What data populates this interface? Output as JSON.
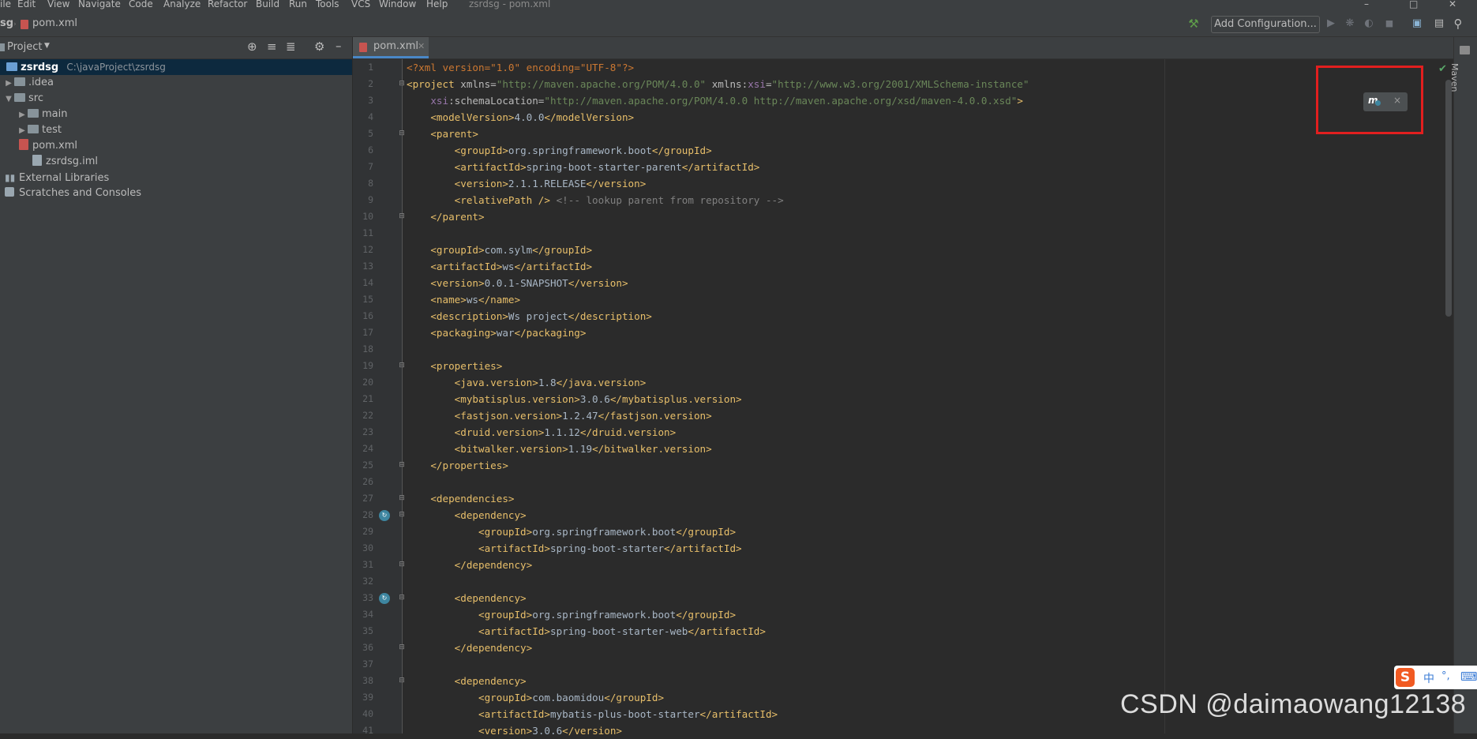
{
  "menu": {
    "items": [
      "ile",
      "Edit",
      "View",
      "Navigate",
      "Code",
      "Analyze",
      "Refactor",
      "Build",
      "Run",
      "Tools",
      "VCS",
      "Window",
      "Help"
    ],
    "window_title": "zsrdsg - pom.xml"
  },
  "breadcrumb": {
    "project": "sg",
    "file": "pom.xml"
  },
  "toolbar": {
    "add_configuration": "Add Configuration...",
    "icons": [
      "hammer-icon",
      "run-icon",
      "debug-icon",
      "coverage-icon",
      "stop-icon",
      "project-structure-icon",
      "layout-icon",
      "search-icon"
    ]
  },
  "project_panel": {
    "title": "Project",
    "tree": [
      {
        "label": "zsrdsg",
        "path": "C:\\javaProject\\zsrdsg",
        "level": 0,
        "expanded": true,
        "kind": "module"
      },
      {
        "label": ".idea",
        "level": 1,
        "expanded": false,
        "kind": "folder"
      },
      {
        "label": "src",
        "level": 1,
        "expanded": true,
        "kind": "folder"
      },
      {
        "label": "main",
        "level": 2,
        "expanded": false,
        "kind": "folder"
      },
      {
        "label": "test",
        "level": 2,
        "expanded": false,
        "kind": "folder"
      },
      {
        "label": "pom.xml",
        "level": 1,
        "kind": "maven-file"
      },
      {
        "label": "zsrdsg.iml",
        "level": 1,
        "kind": "iml-file"
      },
      {
        "label": "External Libraries",
        "level": 0,
        "kind": "libraries"
      },
      {
        "label": "Scratches and Consoles",
        "level": 0,
        "kind": "scratches"
      }
    ]
  },
  "editor": {
    "tab_label": "pom.xml",
    "lines": [
      {
        "n": "1",
        "parts": [
          [
            "pi",
            "<?xml version=\"1.0\" encoding=\"UTF-8\"?>"
          ]
        ]
      },
      {
        "n": "2",
        "parts": [
          [
            "t",
            "<project "
          ],
          [
            "an",
            "xmlns="
          ],
          [
            "av",
            "\"http://maven.apache.org/POM/4.0.0\""
          ],
          [
            "an",
            " xmlns:"
          ],
          [
            "ns",
            "xsi"
          ],
          [
            "an",
            "="
          ],
          [
            "av",
            "\"http://www.w3.org/2001/XMLSchema-instance\""
          ]
        ]
      },
      {
        "n": "3",
        "parts": [
          [
            "ns",
            "    xsi"
          ],
          [
            "an",
            ":schemaLocation="
          ],
          [
            "av",
            "\"http://maven.apache.org/POM/4.0.0 http://maven.apache.org/xsd/maven-4.0.0.xsd\""
          ],
          [
            "t",
            ">"
          ]
        ]
      },
      {
        "n": "4",
        "parts": [
          [
            "t",
            "    <modelVersion>"
          ],
          [
            "x",
            "4.0.0"
          ],
          [
            "t",
            "</modelVersion>"
          ]
        ]
      },
      {
        "n": "5",
        "parts": [
          [
            "t",
            "    <parent>"
          ]
        ]
      },
      {
        "n": "6",
        "parts": [
          [
            "t",
            "        <groupId>"
          ],
          [
            "x",
            "org.springframework.boot"
          ],
          [
            "t",
            "</groupId>"
          ]
        ]
      },
      {
        "n": "7",
        "parts": [
          [
            "t",
            "        <artifactId>"
          ],
          [
            "x",
            "spring-boot-starter-parent"
          ],
          [
            "t",
            "</artifactId>"
          ]
        ]
      },
      {
        "n": "8",
        "parts": [
          [
            "t",
            "        <version>"
          ],
          [
            "x",
            "2.1.1.RELEASE"
          ],
          [
            "t",
            "</version>"
          ]
        ]
      },
      {
        "n": "9",
        "parts": [
          [
            "t",
            "        <relativePath />"
          ],
          [
            "cm",
            " <!-- lookup parent from repository -->"
          ]
        ]
      },
      {
        "n": "10",
        "parts": [
          [
            "t",
            "    </parent>"
          ]
        ]
      },
      {
        "n": "11",
        "parts": []
      },
      {
        "n": "12",
        "parts": [
          [
            "t",
            "    <groupId>"
          ],
          [
            "x",
            "com.sylm"
          ],
          [
            "t",
            "</groupId>"
          ]
        ]
      },
      {
        "n": "13",
        "parts": [
          [
            "t",
            "    <artifactId>"
          ],
          [
            "x",
            "ws"
          ],
          [
            "t",
            "</artifactId>"
          ]
        ]
      },
      {
        "n": "14",
        "parts": [
          [
            "t",
            "    <version>"
          ],
          [
            "x",
            "0.0.1-SNAPSHOT"
          ],
          [
            "t",
            "</version>"
          ]
        ]
      },
      {
        "n": "15",
        "parts": [
          [
            "t",
            "    <name>"
          ],
          [
            "x",
            "ws"
          ],
          [
            "t",
            "</name>"
          ]
        ]
      },
      {
        "n": "16",
        "parts": [
          [
            "t",
            "    <description>"
          ],
          [
            "x",
            "Ws project"
          ],
          [
            "t",
            "</description>"
          ]
        ]
      },
      {
        "n": "17",
        "parts": [
          [
            "t",
            "    <packaging>"
          ],
          [
            "x",
            "war"
          ],
          [
            "t",
            "</packaging>"
          ]
        ]
      },
      {
        "n": "18",
        "parts": []
      },
      {
        "n": "19",
        "parts": [
          [
            "t",
            "    <properties>"
          ]
        ]
      },
      {
        "n": "20",
        "parts": [
          [
            "t",
            "        <java.version>"
          ],
          [
            "x",
            "1.8"
          ],
          [
            "t",
            "</java.version>"
          ]
        ]
      },
      {
        "n": "21",
        "parts": [
          [
            "t",
            "        <mybatisplus.version>"
          ],
          [
            "x",
            "3.0.6"
          ],
          [
            "t",
            "</mybatisplus.version>"
          ]
        ]
      },
      {
        "n": "22",
        "parts": [
          [
            "t",
            "        <fastjson.version>"
          ],
          [
            "x",
            "1.2.47"
          ],
          [
            "t",
            "</fastjson.version>"
          ]
        ]
      },
      {
        "n": "23",
        "parts": [
          [
            "t",
            "        <druid.version>"
          ],
          [
            "x",
            "1.1.12"
          ],
          [
            "t",
            "</druid.version>"
          ]
        ]
      },
      {
        "n": "24",
        "parts": [
          [
            "t",
            "        <bitwalker.version>"
          ],
          [
            "x",
            "1.19"
          ],
          [
            "t",
            "</bitwalker.version>"
          ]
        ]
      },
      {
        "n": "25",
        "parts": [
          [
            "t",
            "    </properties>"
          ]
        ]
      },
      {
        "n": "26",
        "parts": []
      },
      {
        "n": "27",
        "parts": [
          [
            "t",
            "    <dependencies>"
          ]
        ]
      },
      {
        "n": "28",
        "parts": [
          [
            "t",
            "        <dependency>"
          ]
        ]
      },
      {
        "n": "29",
        "parts": [
          [
            "t",
            "            <groupId>"
          ],
          [
            "x",
            "org.springframework.boot"
          ],
          [
            "t",
            "</groupId>"
          ]
        ]
      },
      {
        "n": "30",
        "parts": [
          [
            "t",
            "            <artifactId>"
          ],
          [
            "x",
            "spring-boot-starter"
          ],
          [
            "t",
            "</artifactId>"
          ]
        ]
      },
      {
        "n": "31",
        "parts": [
          [
            "t",
            "        </dependency>"
          ]
        ]
      },
      {
        "n": "32",
        "parts": []
      },
      {
        "n": "33",
        "parts": [
          [
            "t",
            "        <dependency>"
          ]
        ]
      },
      {
        "n": "34",
        "parts": [
          [
            "t",
            "            <groupId>"
          ],
          [
            "x",
            "org.springframework.boot"
          ],
          [
            "t",
            "</groupId>"
          ]
        ]
      },
      {
        "n": "35",
        "parts": [
          [
            "t",
            "            <artifactId>"
          ],
          [
            "x",
            "spring-boot-starter-web"
          ],
          [
            "t",
            "</artifactId>"
          ]
        ]
      },
      {
        "n": "36",
        "parts": [
          [
            "t",
            "        </dependency>"
          ]
        ]
      },
      {
        "n": "37",
        "parts": []
      },
      {
        "n": "38",
        "parts": [
          [
            "t",
            "        <dependency>"
          ]
        ]
      },
      {
        "n": "39",
        "parts": [
          [
            "t",
            "            <groupId>"
          ],
          [
            "x",
            "com.baomidou"
          ],
          [
            "t",
            "</groupId>"
          ]
        ]
      },
      {
        "n": "40",
        "parts": [
          [
            "t",
            "            <artifactId>"
          ],
          [
            "x",
            "mybatis-plus-boot-starter"
          ],
          [
            "t",
            "</artifactId>"
          ]
        ]
      },
      {
        "n": "41",
        "parts": [
          [
            "t",
            "            <version>"
          ],
          [
            "x",
            "3.0.6"
          ],
          [
            "t",
            "</version>"
          ]
        ]
      }
    ],
    "fold_markers": [
      "2",
      "5",
      "10",
      "19",
      "25",
      "27",
      "28",
      "31",
      "33",
      "36",
      "38"
    ],
    "gutter_icons": [
      "28",
      "33"
    ]
  },
  "right_strip": {
    "maven_label": "Maven"
  },
  "maven_popup": {
    "icon": "maven-reload-icon",
    "close": "×"
  },
  "watermark": "CSDN @daimaowang12138",
  "ime": {
    "logo": "S",
    "lang": "中",
    "punct": "°,"
  },
  "colors": {
    "accent": "#4a88c7",
    "highlight_box": "#e21f1f",
    "inspection_ok": "#59a869"
  }
}
